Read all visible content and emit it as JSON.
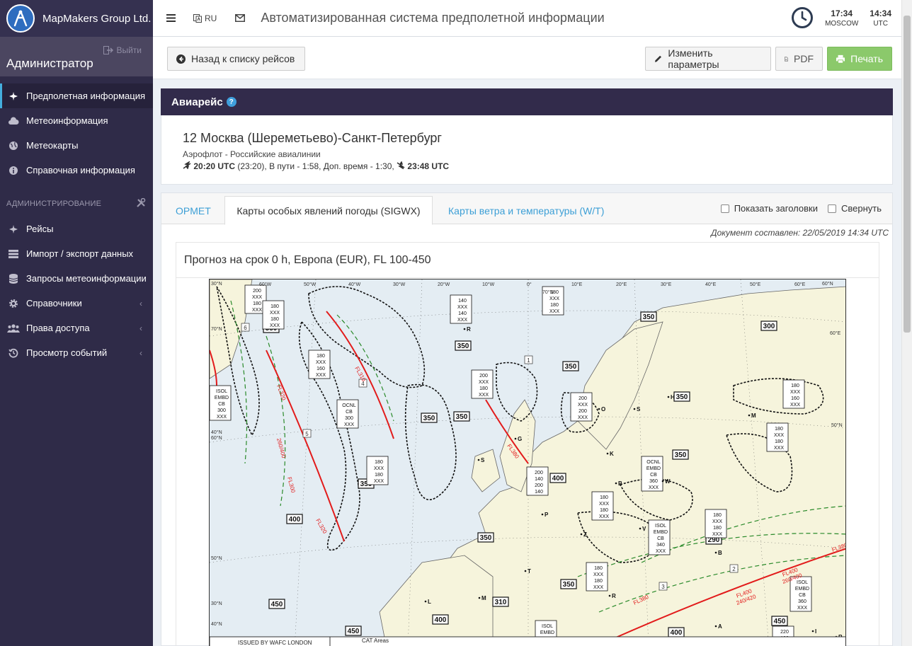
{
  "brand": {
    "name": "MapMakers Group Ltd."
  },
  "user": {
    "role": "Администратор",
    "logout": "Выйти"
  },
  "menu": {
    "items": [
      {
        "label": "Предполетная информация"
      },
      {
        "label": "Метеоинформация"
      },
      {
        "label": "Метеокарты"
      },
      {
        "label": "Справочная информация"
      }
    ],
    "admin_header": "АДМИНИСТРИРОВАНИЕ",
    "admin_items": [
      {
        "label": "Рейсы"
      },
      {
        "label": "Импорт / экспорт данных"
      },
      {
        "label": "Запросы метеоинформации"
      },
      {
        "label": "Справочники"
      },
      {
        "label": "Права доступа"
      },
      {
        "label": "Просмотр событий"
      }
    ]
  },
  "topbar": {
    "lang": "RU",
    "title": "Автоматизированная система предполетной информации",
    "clock_local": {
      "time": "17:34",
      "zone": "MOSCOW"
    },
    "clock_utc": {
      "time": "14:34",
      "zone": "UTC"
    }
  },
  "toolbar": {
    "back_label": "Назад к списку рейсов",
    "edit_label": "Изменить параметры",
    "pdf_label": "PDF",
    "print_label": "Печать"
  },
  "flight": {
    "panel_title": "Авиарейс",
    "title": "12 Москва (Шереметьево)-Санкт-Петербург",
    "airline": "Аэрофлот - Российские авиалинии",
    "dep_time": "20:20 UTC",
    "times_middle": "(23:20), В пути - 1:58, Доп. время - 1:30,",
    "arr_time": "23:48 UTC"
  },
  "tabs": [
    {
      "label": "OPMET"
    },
    {
      "label": "Карты особых явлений погоды (SIGWX)"
    },
    {
      "label": "Карты ветра и температуры (W/T)"
    }
  ],
  "options": {
    "show_headers": "Показать заголовки",
    "collapse": "Свернуть"
  },
  "document": {
    "composed": "Документ составлен: 22/05/2019 14:34 UTC"
  },
  "forecast": {
    "title": "Прогноз на срок 0 h, Европа (EUR), FL 100-450",
    "map": {
      "longitudes": [
        "60°W",
        "50°W",
        "40°W",
        "30°W",
        "20°W",
        "10°W",
        "0°",
        "10°E",
        "20°E",
        "30°E",
        "40°E",
        "50°E",
        "60°E"
      ],
      "lat_labels": [
        "70°N",
        "60°N",
        "50°N",
        "40°N",
        "30°N"
      ],
      "lat_labels_extra": [
        "70°N",
        "60°N",
        "60°E",
        "50°N",
        "40°N",
        "30°N"
      ],
      "footer_left": "ISSUED BY WAFC LONDON",
      "footer_right": "CAT Areas",
      "tropopause_boxes": [
        "350",
        "350",
        "350",
        "300",
        "350",
        "350",
        "350",
        "350",
        "350",
        "350",
        "400",
        "400",
        "350",
        "290",
        "310",
        "350",
        "450",
        "400",
        "450",
        "400",
        "450"
      ],
      "cloud_labels": [
        {
          "lines": [
            "200",
            "XXX",
            "180",
            "XXX"
          ]
        },
        {
          "lines": [
            "180",
            "XXX",
            "180",
            "XXX"
          ]
        },
        {
          "lines": [
            "180",
            "XXX",
            "160",
            "XXX"
          ]
        },
        {
          "lines": [
            "140",
            "XXX",
            "140",
            "XXX"
          ]
        },
        {
          "lines": [
            "180",
            "XXX",
            "180",
            "XXX"
          ]
        },
        {
          "lines": [
            "OCNL",
            "CB",
            "300",
            "XXX"
          ]
        },
        {
          "lines": [
            "ISOL",
            "EMBD",
            "CB",
            "300",
            "XXX"
          ]
        },
        {
          "lines": [
            "200",
            "XXX",
            "180",
            "XXX"
          ]
        },
        {
          "lines": [
            "180",
            "XXX",
            "180",
            "XXX"
          ]
        },
        {
          "lines": [
            "200",
            "XXX",
            "200",
            "XXX"
          ]
        },
        {
          "lines": [
            "180",
            "XXX",
            "160",
            "XXX"
          ]
        },
        {
          "lines": [
            "180",
            "XXX",
            "180",
            "XXX"
          ]
        },
        {
          "lines": [
            "OCNL",
            "EMBD",
            "CB",
            "360",
            "XXX"
          ]
        },
        {
          "lines": [
            "180",
            "XXX",
            "180",
            "XXX"
          ]
        },
        {
          "lines": [
            "ISOL",
            "EMBD",
            "CB",
            "340",
            "XXX"
          ]
        },
        {
          "lines": [
            "180",
            "XXX",
            "180",
            "XXX"
          ]
        },
        {
          "lines": [
            "200",
            "140",
            "200",
            "140"
          ]
        },
        {
          "lines": [
            "180",
            "XXX",
            "180",
            "XXX"
          ]
        },
        {
          "lines": [
            "ISOL",
            "EMBD",
            "CB",
            "360",
            "XXX"
          ]
        },
        {
          "lines": [
            "ISOL",
            "EMBD",
            "CB",
            "280",
            "XXX"
          ]
        },
        {
          "lines": [
            "220",
            "120",
            "220",
            "XXX"
          ]
        }
      ],
      "jet_labels": [
        "FL320",
        "FL310",
        "FL320",
        "FL300",
        "FL380",
        "FL380",
        "FL400",
        "FL400",
        "FL380"
      ],
      "jet_depth_labels": [
        "260/400",
        "240/420",
        "260/400"
      ],
      "cat_numbers": [
        "1",
        "2",
        "3",
        "4",
        "5",
        "6"
      ],
      "cities": [
        "R",
        "O",
        "S",
        "H",
        "K",
        "B",
        "W",
        "G",
        "S",
        "P",
        "V",
        "Z",
        "B",
        "T",
        "M",
        "L",
        "R",
        "A",
        "B",
        "M",
        "I"
      ]
    }
  }
}
